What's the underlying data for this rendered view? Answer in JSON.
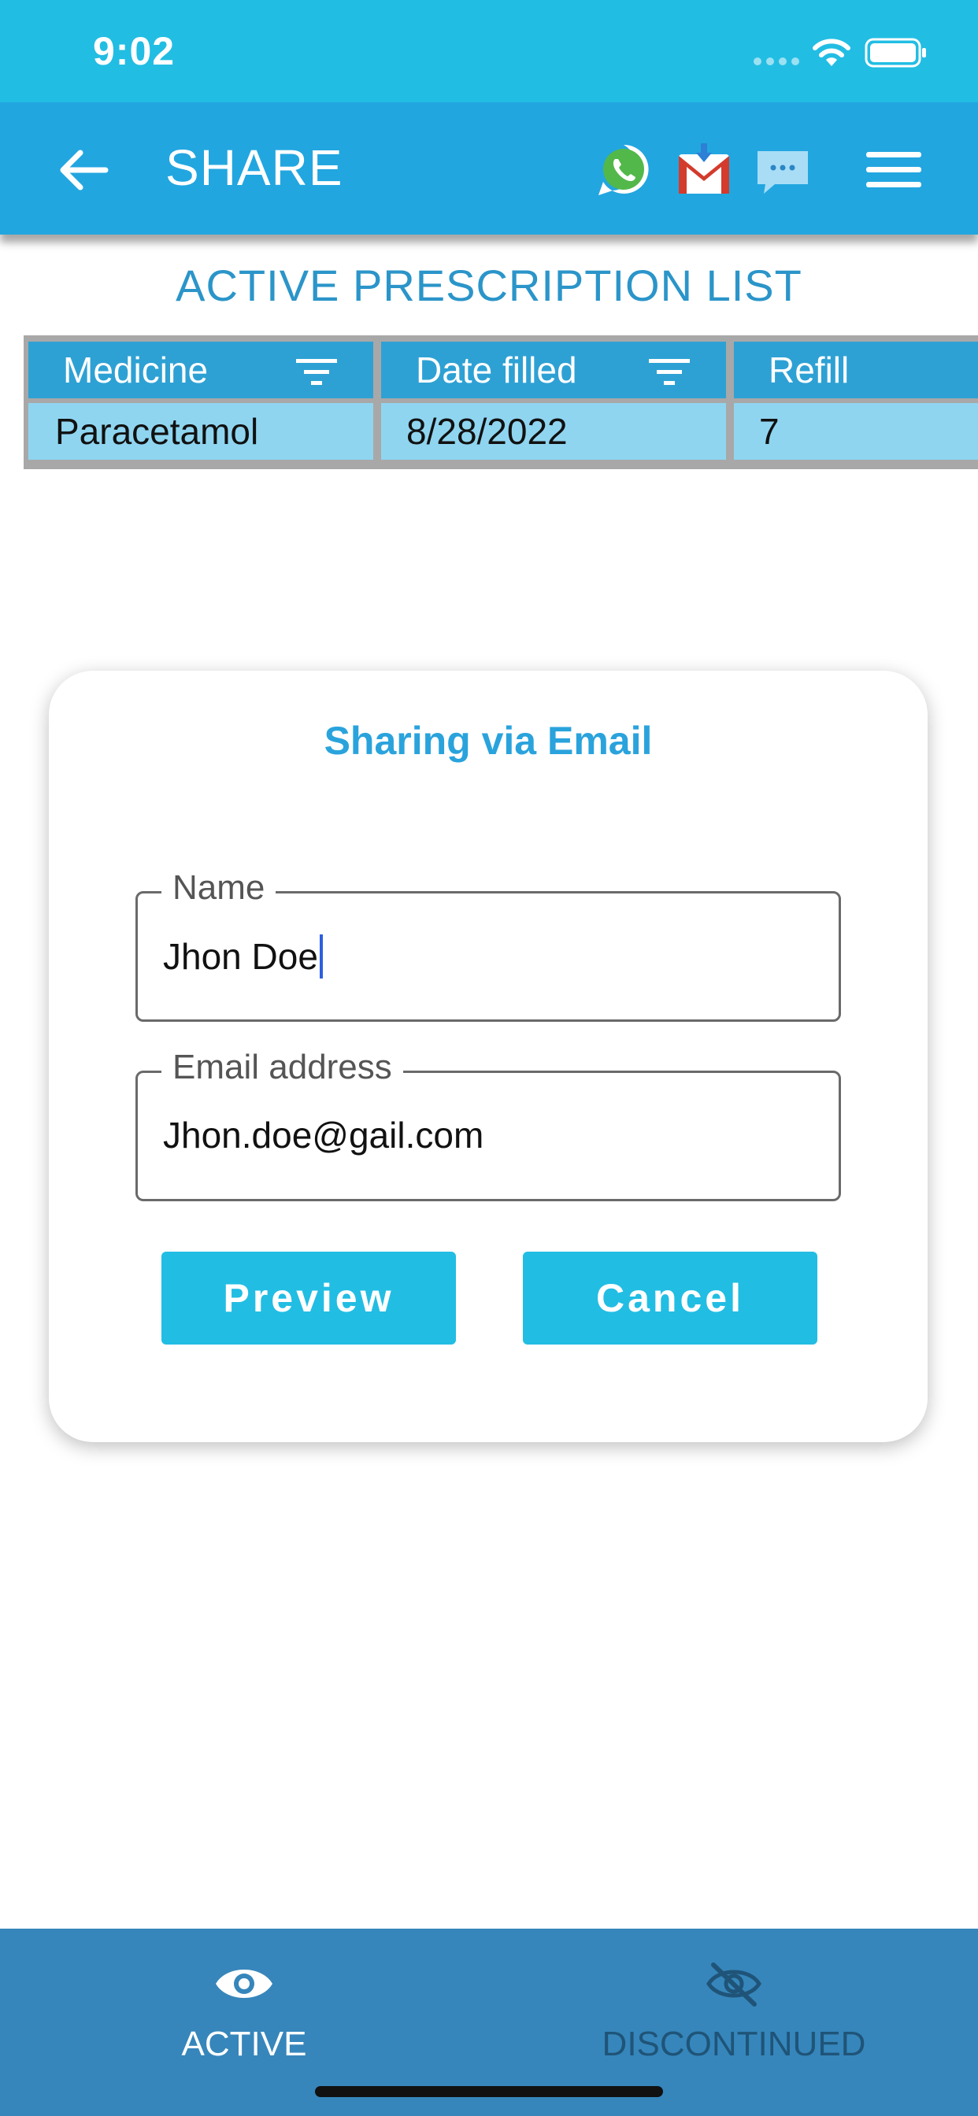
{
  "status_bar": {
    "time": "9:02"
  },
  "app_bar": {
    "title": "SHARE",
    "icons": {
      "back": "arrow-left-icon",
      "whatsapp": "whatsapp-icon",
      "gmail": "gmail-icon",
      "sms": "message-icon",
      "menu": "menu-icon"
    }
  },
  "list": {
    "title": "ACTIVE PRESCRIPTION LIST",
    "columns": [
      "Medicine",
      "Date filled",
      "Refill"
    ],
    "rows": [
      [
        "Paracetamol",
        "8/28/2022",
        "7"
      ]
    ]
  },
  "dialog": {
    "title": "Sharing via Email",
    "name_field": {
      "label": "Name",
      "value": "Jhon Doe"
    },
    "email_field": {
      "label": "Email address",
      "value": "Jhon.doe@gail.com"
    },
    "preview_label": "Preview",
    "cancel_label": "Cancel"
  },
  "bottom_nav": {
    "active_label": "ACTIVE",
    "discontinued_label": "DISCONTINUED"
  },
  "colors": {
    "status_bar": "#22bde3",
    "app_bar": "#22a6e0",
    "accent": "#22bde3",
    "table_header": "#2ea1d4",
    "table_row": "#8fd5f0",
    "bottom_nav": "#3686bb"
  }
}
